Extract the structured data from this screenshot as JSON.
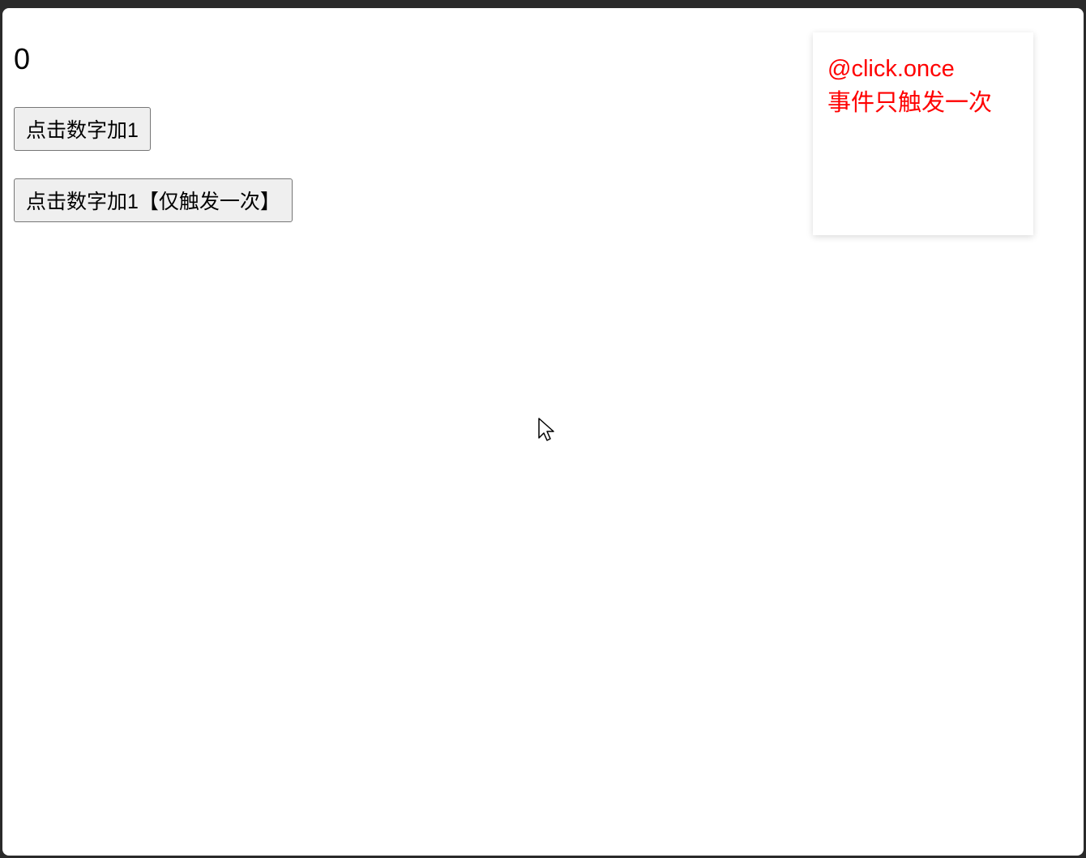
{
  "counter": {
    "value": "0"
  },
  "buttons": {
    "increment": "点击数字加1",
    "increment_once": "点击数字加1【仅触发一次】"
  },
  "annotation": {
    "line1": "@click.once",
    "line2": "事件只触发一次"
  }
}
